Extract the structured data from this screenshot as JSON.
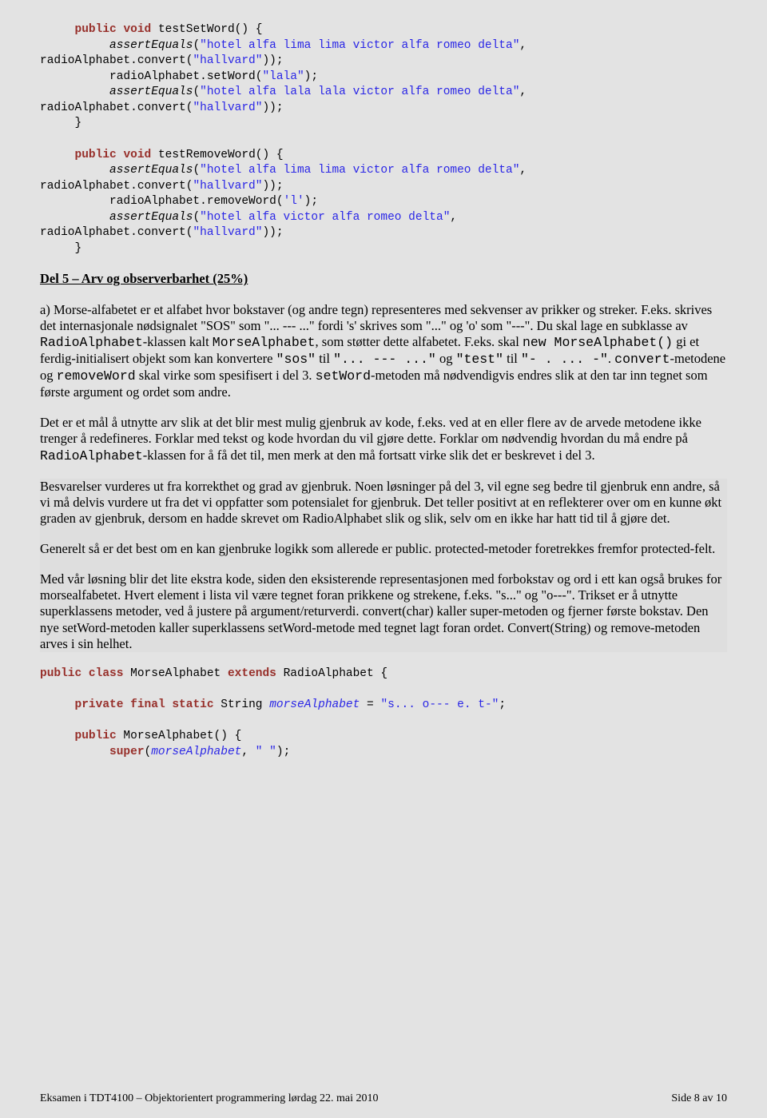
{
  "code1": {
    "l1a": "     ",
    "l1b": "public",
    "l1c": " ",
    "l1d": "void",
    "l1e": " testSetWord() {",
    "l2a": "          ",
    "l2b": "assertEquals",
    "l2c": "(",
    "l2d": "\"hotel alfa lima lima victor alfa romeo delta\"",
    "l2e": ",",
    "l3a": "radioAlphabet.convert(",
    "l3b": "\"hallvard\"",
    "l3c": "));",
    "l4a": "          radioAlphabet.setWord(",
    "l4b": "\"lala\"",
    "l4c": ");",
    "l5a": "          ",
    "l5b": "assertEquals",
    "l5c": "(",
    "l5d": "\"hotel alfa lala lala victor alfa romeo delta\"",
    "l5e": ",",
    "l6a": "radioAlphabet.convert(",
    "l6b": "\"hallvard\"",
    "l6c": "));",
    "l7": "     }",
    "l8": "",
    "l9a": "     ",
    "l9b": "public",
    "l9c": " ",
    "l9d": "void",
    "l9e": " testRemoveWord() {",
    "l10a": "          ",
    "l10b": "assertEquals",
    "l10c": "(",
    "l10d": "\"hotel alfa lima lima victor alfa romeo delta\"",
    "l10e": ",",
    "l11a": "radioAlphabet.convert(",
    "l11b": "\"hallvard\"",
    "l11c": "));",
    "l12a": "          radioAlphabet.removeWord(",
    "l12b": "'l'",
    "l12c": ");",
    "l13a": "          ",
    "l13b": "assertEquals",
    "l13c": "(",
    "l13d": "\"hotel alfa victor alfa romeo delta\"",
    "l13e": ",",
    "l14a": "radioAlphabet.convert(",
    "l14b": "\"hallvard\"",
    "l14c": "));",
    "l15": "     }"
  },
  "section_title": "Del 5 – Arv og observerbarhet (25%)",
  "para_a": {
    "t1": "a) Morse-alfabetet er et alfabet hvor bokstaver (og andre tegn) representeres med sekvenser av prikker og streker. F.eks. skrives det internasjonale nødsignalet \"SOS\" som \"... --- ...\" fordi 's' skrives som \"...\" og 'o' som \"---\". Du skal lage en subklasse av ",
    "m1": "RadioAlphabet",
    "t2": "-klassen kalt ",
    "m2": "MorseAlphabet",
    "t3": ", som støtter dette alfabetet. F.eks. skal ",
    "m3": "new MorseAlphabet()",
    "t4": " gi et ferdig-initialisert objekt som kan konvertere ",
    "m4": "\"sos\"",
    "t5": " til ",
    "m5": "\"... --- ...\"",
    "t6": " og ",
    "m6": "\"test\"",
    "t7": " til ",
    "m7": "\"- . ... -\"",
    "t8": ". ",
    "m8": "convert",
    "t9": "-metodene og ",
    "m9": "removeWord",
    "t10": " skal virke som spesifisert i del 3. ",
    "m10": "setWord",
    "t11": "-metoden må nødvendigvis endres slik at den tar inn tegnet som første argument og ordet som andre."
  },
  "para_b": {
    "t1": "Det er et mål å utnytte arv slik at det blir mest mulig gjenbruk av kode, f.eks. ved at en eller flere av de arvede metodene ikke trenger å redefineres. Forklar med tekst og kode hvordan du vil gjøre dette. Forklar om nødvendig hvordan du må endre på ",
    "m1": "RadioAlphabet",
    "t2": "-klassen for å få det til, men merk at den må fortsatt virke slik det er beskrevet i del 3."
  },
  "hl1": "Besvarelser vurderes ut fra korrekthet og grad av gjenbruk. Noen løsninger på del 3, vil egne seg bedre til gjenbruk enn andre, så vi må delvis vurdere ut fra det vi oppfatter som potensialet for gjenbruk. Det teller positivt at en reflekterer over om en kunne økt graden av gjenbruk, dersom en hadde skrevet om RadioAlphabet slik og slik, selv om en ikke har hatt tid til å gjøre det.",
  "hl2": "Generelt så er det best om en kan gjenbruke logikk som allerede er public. protected-metoder foretrekkes fremfor protected-felt.",
  "hl3": "Med vår løsning blir det lite ekstra kode, siden den eksisterende representasjonen med forbokstav og ord i ett kan også brukes for morsealfabetet. Hvert element i lista vil være tegnet foran prikkene og strekene, f.eks. \"s...\" og \"o---\". Trikset er å utnytte superklassens metoder, ved å justere på argument/returverdi. convert(char) kaller super-metoden og fjerner første bokstav. Den nye setWord-metoden kaller superklassens setWord-metode med tegnet lagt foran ordet. Convert(String) og remove-metoden arves i sin helhet.",
  "code2": {
    "l1a": "public",
    "l1b": " ",
    "l1c": "class",
    "l1d": " MorseAlphabet ",
    "l1e": "extends",
    "l1f": " RadioAlphabet {",
    "l2": "",
    "l3a": "     ",
    "l3b": "private",
    "l3c": " ",
    "l3d": "final",
    "l3e": " ",
    "l3f": "static",
    "l3g": " String ",
    "l3h": "morseAlphabet",
    "l3i": " = ",
    "l3j": "\"s... o--- e. t-\"",
    "l3k": ";",
    "l4": "",
    "l5a": "     ",
    "l5b": "public",
    "l5c": " MorseAlphabet() {",
    "l6a": "          ",
    "l6b": "super",
    "l6c": "(",
    "l6d": "morseAlphabet",
    "l6e": ", ",
    "l6f": "\" \"",
    "l6g": ");"
  },
  "footer_left": "Eksamen i TDT4100 – Objektorientert programmering lørdag 22. mai 2010",
  "footer_right": "Side 8 av 10"
}
